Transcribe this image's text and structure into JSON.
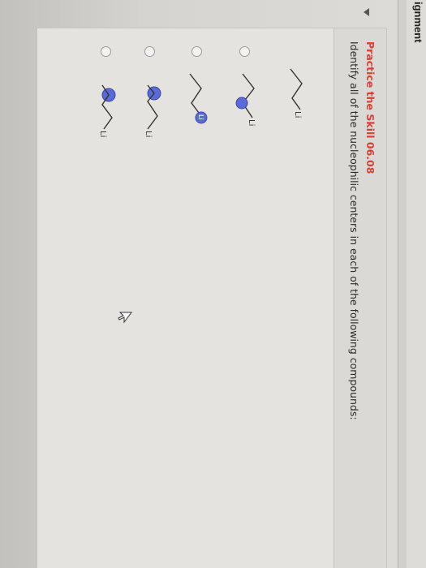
{
  "window": {
    "tab_label": "ignment"
  },
  "practice": {
    "title": "Practice the Skill 06.08",
    "question": "Identify all of the nucleophilic centers in each of the following compounds:"
  },
  "compounds": [
    {
      "label": "Li",
      "circled_atoms": 0
    },
    {
      "label": "Li",
      "circled_atoms": 1
    },
    {
      "label": "Li",
      "circled_atoms": 1
    },
    {
      "label": "Li",
      "circled_atoms": 1
    },
    {
      "label": "Li",
      "circled_atoms": 1
    }
  ],
  "colors": {
    "title_red": "#d2443a",
    "highlight_blue": "#5b6ad6"
  }
}
